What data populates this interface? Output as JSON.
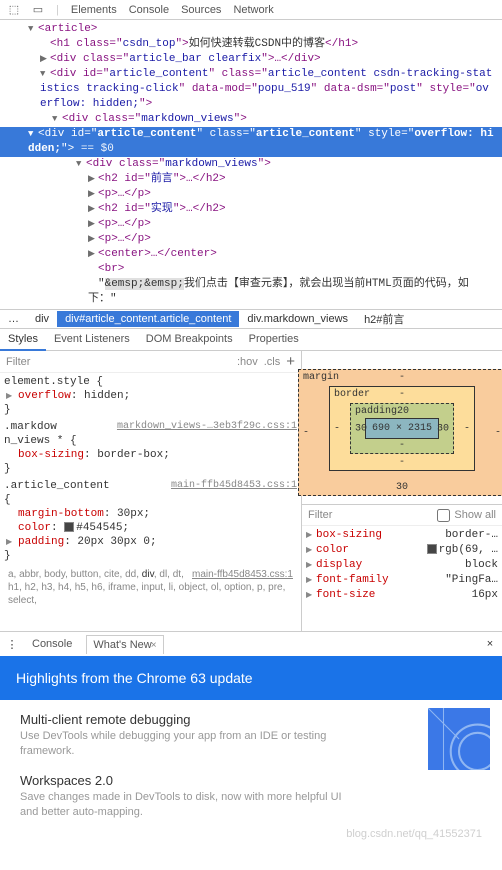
{
  "top_tabs": {
    "elements": "Elements",
    "console": "Console",
    "sources": "Sources",
    "network": "Network"
  },
  "first_child_icon": "⚙",
  "dom": {
    "n0": "<article>",
    "n1_open": "<h1 class=\"",
    "n1_cls": "csdn_top",
    "n1_mid": "\">",
    "n1_text": "如何快速转载CSDN中的博客",
    "n1_close": "</h1>",
    "n2": "<div class=\"",
    "n2_cls": "article_bar clearfix",
    "n2_mid": "\">…</div>",
    "n3_a": "<div id=\"",
    "n3_id": "article_content",
    "n3_b": "\" class=\"",
    "n3_cls": "article_content csdn-tracking-statistics tracking-click",
    "n3_c": "\" data-mod=\"",
    "n3_dm": "popu_519",
    "n3_d": "\" data-dsm=\"",
    "n3_ds": "post",
    "n3_e": "\" style=\"",
    "n3_st": "overflow: hidden;",
    "n3_f": "\">",
    "n4": "<div class=\"",
    "n4_cls": "markdown_views",
    "n4_mid": "\">",
    "sel_a": "<div id=\"",
    "sel_id": "article_content",
    "sel_b": "\" class=\"",
    "sel_cls": "article_content",
    "sel_c": "\" style=\"",
    "sel_st": "overflow: hidden;",
    "sel_d": "\">",
    "sel_eq": " == $0",
    "n5": "<div class=\"",
    "n5_cls": "markdown_views",
    "n5_mid": "\">",
    "n6_a": "<h2 id=\"",
    "n6_id": "前言",
    "n6_b": "\">…</h2>",
    "n7": "<p>…</p>",
    "n8_a": "<h2 id=\"",
    "n8_id": "实现",
    "n8_b": "\">…</h2>",
    "n9": "<p>…</p>",
    "n10": "<p>…</p>",
    "n11": "<center>…</center>",
    "n12": "<br>",
    "n13_q": "\"",
    "n13_text": "&emsp;&emsp;我们点击【审查元素】，就会出现当前HTML页面的代码，如下：",
    "n13_q2": "\""
  },
  "breadcrumb": {
    "dots": "…",
    "div": "div",
    "active": "div#article_content.article_content",
    "next1": "div.markdown_views",
    "next2": "h2#前言"
  },
  "sub_tabs": {
    "styles": "Styles",
    "ev": "Event Listeners",
    "dom": "DOM Breakpoints",
    "props": "Properties"
  },
  "filter": {
    "placeholder": "Filter",
    "hov": ":hov",
    "cls": ".cls",
    "plus": "+"
  },
  "rules": {
    "r1_sel": "element.style {",
    "r1_p1_name": "overflow",
    "r1_p1_val": "hidden;",
    "r2_sel_a": ".markdow ",
    "r2_link": "markdown_views-…3eb3f29c.css:1",
    "r2_sel_b": "n_views * {",
    "r2_p1_name": "box-sizing",
    "r2_p1_val": "border-box;",
    "r3_sel": ".article_content",
    "r3_link": "main-ffb45d8453.css:1",
    "r3_brace": "{",
    "r3_p1_name": "margin-bottom",
    "r3_p1_val": "30px;",
    "r3_p2_name": "color",
    "r3_p2_val": "#454545;",
    "r3_p2_swatch": "#454545",
    "r3_p3_name": "padding",
    "r3_p3_val": "20px 30px 0;",
    "matched_link": "main-ffb45d8453.css:1",
    "matched_a": "a, abbr, body, button, cite, dd, ",
    "matched_div": "div",
    "matched_b": ", dl, dt, h1, h2, h3, h4, h5, h6, iframe, input, li, object, ol, option, p, pre, select,",
    "close_brace": "}"
  },
  "box_model": {
    "margin": "margin",
    "border": "border",
    "padding": "padding",
    "p_top": "20",
    "p_right": "30",
    "p_left": "30",
    "p_bottom": "-",
    "content": "690 × 2315",
    "m_bottom": "30",
    "dash": "-"
  },
  "computed": {
    "filter": "Filter",
    "show_all": "Show all",
    "rows": [
      {
        "name": "box-sizing",
        "val": "border-…"
      },
      {
        "name": "color",
        "val": "rgb(69, …",
        "swatch": "#454545"
      },
      {
        "name": "display",
        "val": "block"
      },
      {
        "name": "font-family",
        "val": "\"PingFa…"
      },
      {
        "name": "font-size",
        "val": "16px"
      }
    ]
  },
  "drawer": {
    "console": "Console",
    "whatsnew": "What's New",
    "x": "×",
    "banner": "Highlights from the Chrome 63 update",
    "item1_title": "Multi-client remote debugging",
    "item1_desc": "Use DevTools while debugging your app from an IDE or testing framework.",
    "item2_title": "Workspaces 2.0",
    "item2_desc": "Save changes made in DevTools to disk, now with more helpful UI and better auto-mapping."
  },
  "watermark": "blog.csdn.net/qq_41552371"
}
